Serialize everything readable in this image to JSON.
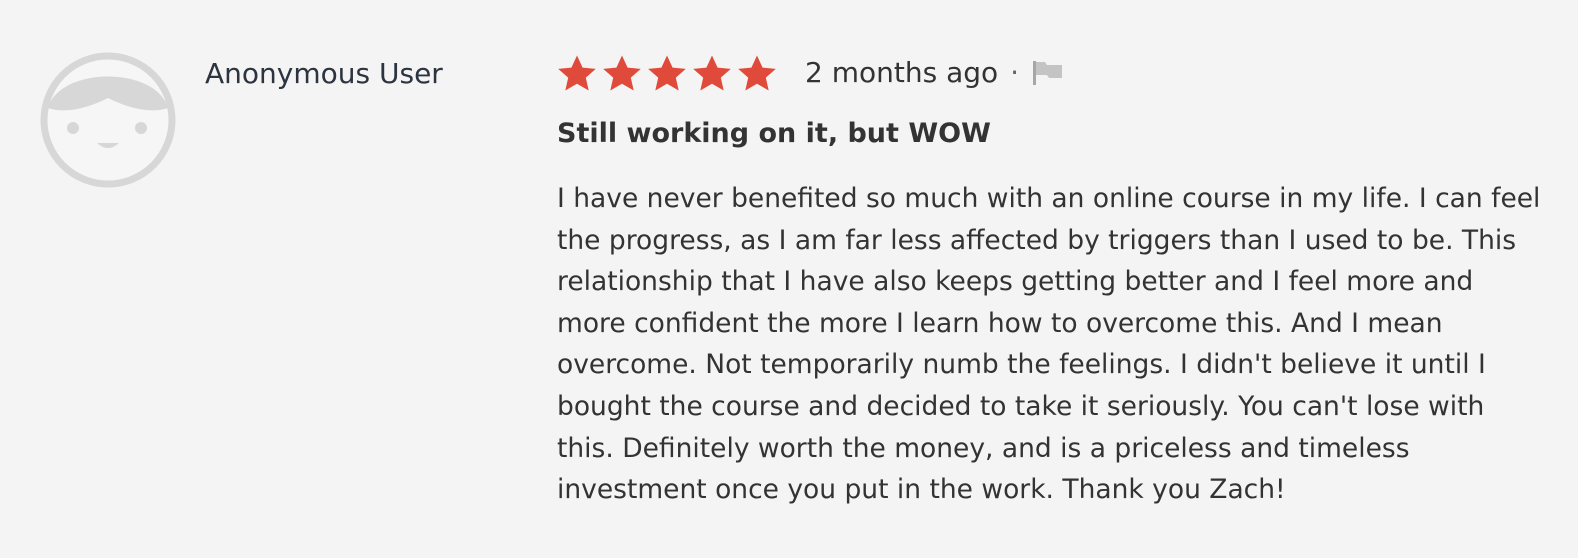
{
  "review": {
    "avatar_icon": "default-user-avatar-icon",
    "author": "Anonymous User",
    "rating": 5,
    "rating_max": 5,
    "star_color": "#e04a3a",
    "date": "2 months ago",
    "separator": "·",
    "flag_icon": "flag-icon",
    "title": "Still working on it, but WOW",
    "body": "I have never benefited so much with an online course in my life. I can feel the progress, as I am far less affected by triggers than I used to be. This relationship that I have also keeps getting better and I feel more and more confident the more I learn how to overcome this. And I mean overcome. Not temporarily numb the feelings. I didn't believe it until I bought the course and decided to take it seriously. You can't lose with this. Definitely worth the money, and is a priceless and timeless investment once you put in the work. Thank you Zach!"
  }
}
